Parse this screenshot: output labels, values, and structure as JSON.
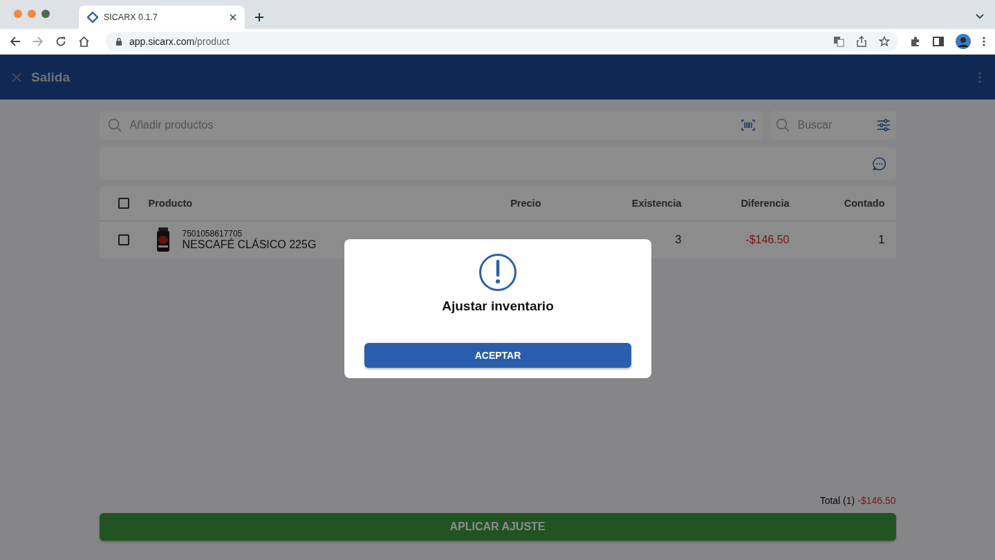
{
  "browser": {
    "tab_title": "SICARX 0.1.7",
    "url_host": "app.sicarx.com",
    "url_path": "/product"
  },
  "app_bar": {
    "title": "Salida"
  },
  "search": {
    "placeholder": "Añadir productos"
  },
  "filter_search": {
    "placeholder": "Buscar"
  },
  "table": {
    "columns": [
      "Producto",
      "Precio",
      "Existencia",
      "Diferencia",
      "Contado"
    ],
    "all_selected": false,
    "rows": [
      {
        "selected": false,
        "code": "7501058617705",
        "name": "NESCAFÉ CLÁSICO 225G",
        "stock": "3",
        "difference": "-$146.50",
        "counted": "1"
      }
    ]
  },
  "footer": {
    "total_label": "Total (1)",
    "total_value": "-$146.50",
    "button": "APLICAR AJUSTE"
  },
  "dialog": {
    "title": "Ajustar inventario",
    "button": "ACEPTAR"
  }
}
